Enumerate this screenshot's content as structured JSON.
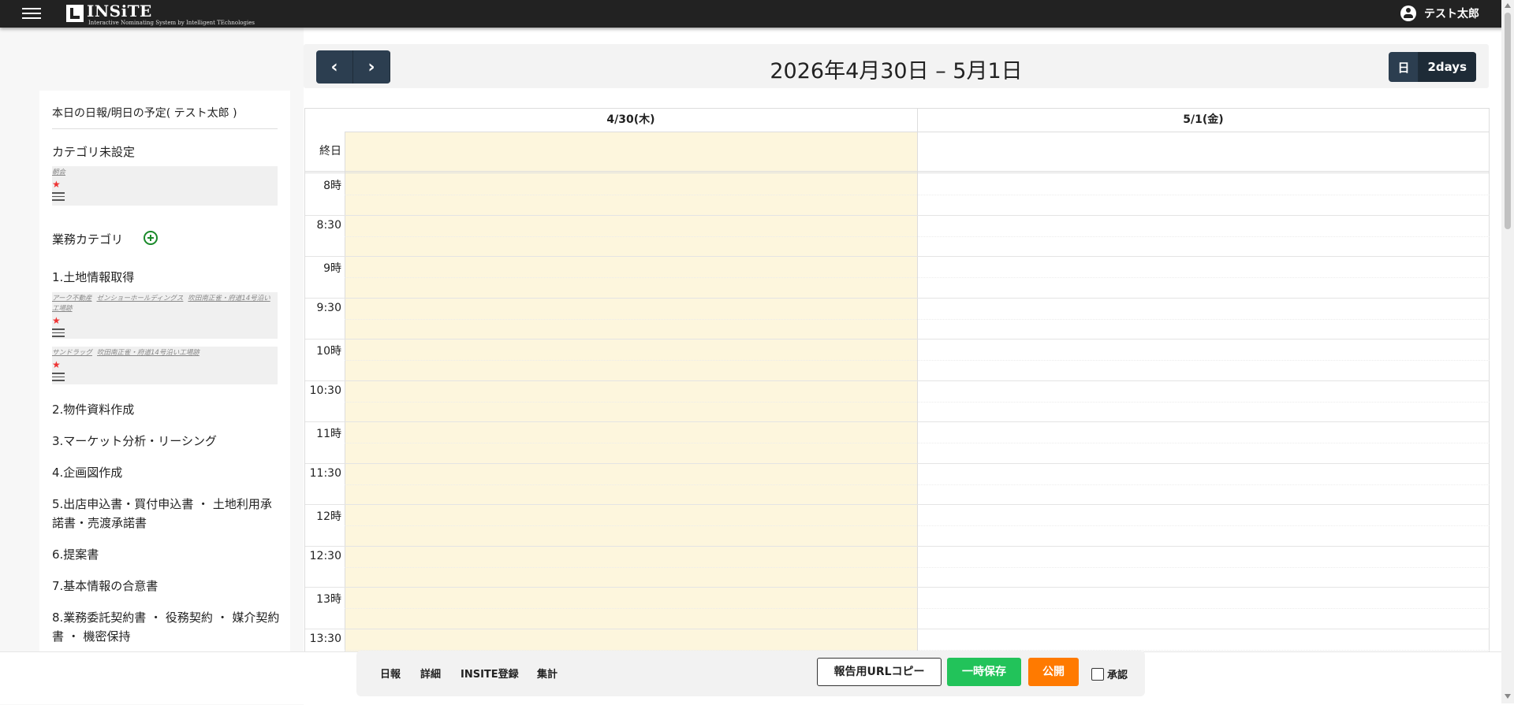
{
  "app": {
    "logo_title": "INSiTE",
    "logo_subtitle": "Interactive Nominating System by Intelligent TEchnologies",
    "user_name": "テスト太郎"
  },
  "sidebar": {
    "title": "本日の日報/明日の予定( テスト太郎 )",
    "uncategorized": {
      "heading": "カテゴリ未設定",
      "card": {
        "tags": [
          "朝会"
        ],
        "star": "★"
      }
    },
    "business_heading": "業務カテゴリ",
    "categories": [
      {
        "label": "1.土地情報取得",
        "cards": [
          {
            "tags": [
              "アーク不動産",
              "ゼンショーホールディングス",
              "吹田南正雀・府道14号沿い工場跡"
            ],
            "star": "★"
          },
          {
            "tags": [
              "サンドラッグ",
              "吹田南正雀・府道14号沿い工場跡"
            ],
            "star": "★"
          }
        ]
      },
      {
        "label": "2.物件資料作成"
      },
      {
        "label": "3.マーケット分析・リーシング"
      },
      {
        "label": "4.企画図作成"
      },
      {
        "label": "5.出店申込書・買付申込書 ・ 土地利用承諾書・売渡承諾書"
      },
      {
        "label": "6.提案書"
      },
      {
        "label": "7.基本情報の合意書"
      },
      {
        "label": "8.業務委託契約書 ・ 役務契約 ・ 媒介契約書 ・ 機密保持"
      }
    ]
  },
  "calendar": {
    "title": "2026年4月30日 – 5月1日",
    "prev_label": "‹",
    "next_label": "›",
    "views": [
      "日",
      "2days"
    ],
    "active_view": "2days",
    "days": [
      "4/30(木)",
      "5/1(金)"
    ],
    "today_index": 0,
    "allday_label": "終日",
    "time_labels": [
      "8時",
      "8:30",
      "9時",
      "9:30",
      "10時",
      "10:30",
      "11時",
      "11:30",
      "12時",
      "12:30",
      "13時",
      "13:30"
    ],
    "today_color": "#fdf6dd"
  },
  "bottombar": {
    "links": [
      "日報",
      "詳細",
      "INSITE登録",
      "集計"
    ],
    "copy_url": "報告用URLコピー",
    "save_temp": "一時保存",
    "publish": "公開",
    "approve": "承認"
  },
  "colors": {
    "topbar": "#222222",
    "nav_button": "#2c3e50",
    "save_green": "#22c35a",
    "publish_orange": "#ff7a00",
    "add_icon": "#1a8a2a"
  }
}
